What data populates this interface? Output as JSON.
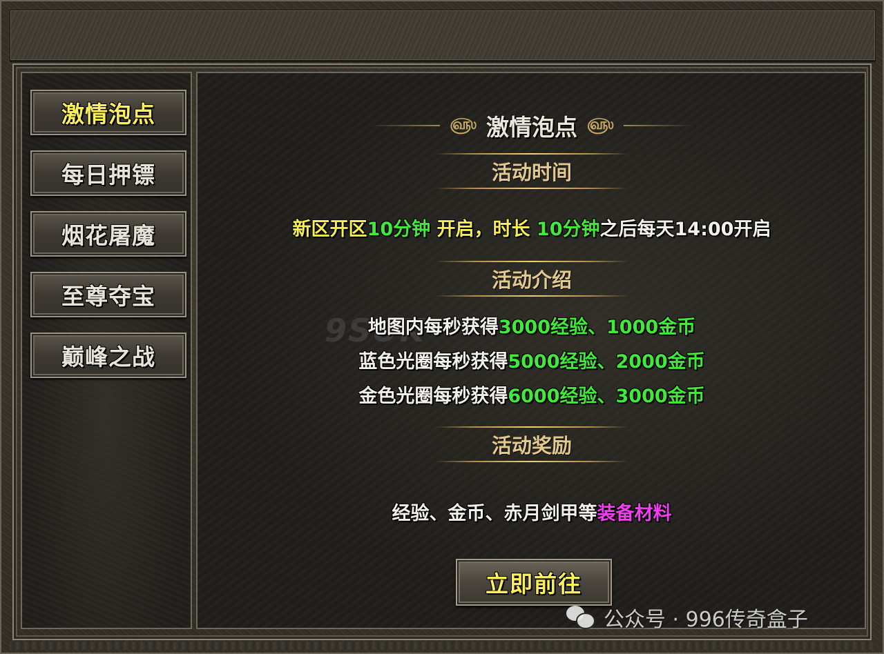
{
  "sidebar": {
    "items": [
      {
        "label": "激情泡点",
        "active": true
      },
      {
        "label": "每日押镖",
        "active": false
      },
      {
        "label": "烟花屠魔",
        "active": false
      },
      {
        "label": "至尊夺宝",
        "active": false
      },
      {
        "label": "巅峰之战",
        "active": false
      }
    ]
  },
  "panel": {
    "title": "激情泡点",
    "ornament": "௵",
    "time_heading": "活动时间",
    "time_line": [
      {
        "text": "新区开区",
        "color": "yellow"
      },
      {
        "text": "10分钟",
        "color": "green"
      },
      {
        "text": " 开启，时长 ",
        "color": "yellow"
      },
      {
        "text": "10分钟",
        "color": "green"
      },
      {
        "text": "之后每天14:00开启",
        "color": "white"
      }
    ],
    "intro_heading": "活动介绍",
    "intro_lines": [
      [
        {
          "text": "地图内每秒获得",
          "color": "white"
        },
        {
          "text": "3000经验、1000金币",
          "color": "green"
        }
      ],
      [
        {
          "text": "蓝色光圈每秒获得",
          "color": "white"
        },
        {
          "text": "5000经验、2000金币",
          "color": "green"
        }
      ],
      [
        {
          "text": "金色光圈每秒获得",
          "color": "white"
        },
        {
          "text": "6000经验、3000金币",
          "color": "green"
        }
      ]
    ],
    "reward_heading": "活动奖励",
    "reward_line": [
      {
        "text": "经验、金币、赤月剑甲等",
        "color": "white"
      },
      {
        "text": "装备材料",
        "color": "magenta"
      }
    ],
    "go_button": "立即前往"
  },
  "watermark": {
    "logo_text": "9SUK",
    "wechat_text": "公众号 · 996传奇盒子"
  },
  "colors": {
    "yellow": "#f5ee55",
    "green": "#42e83a",
    "white": "#f2f0ea",
    "magenta": "#f03ef0",
    "heading_gold": "#e4c98e"
  }
}
